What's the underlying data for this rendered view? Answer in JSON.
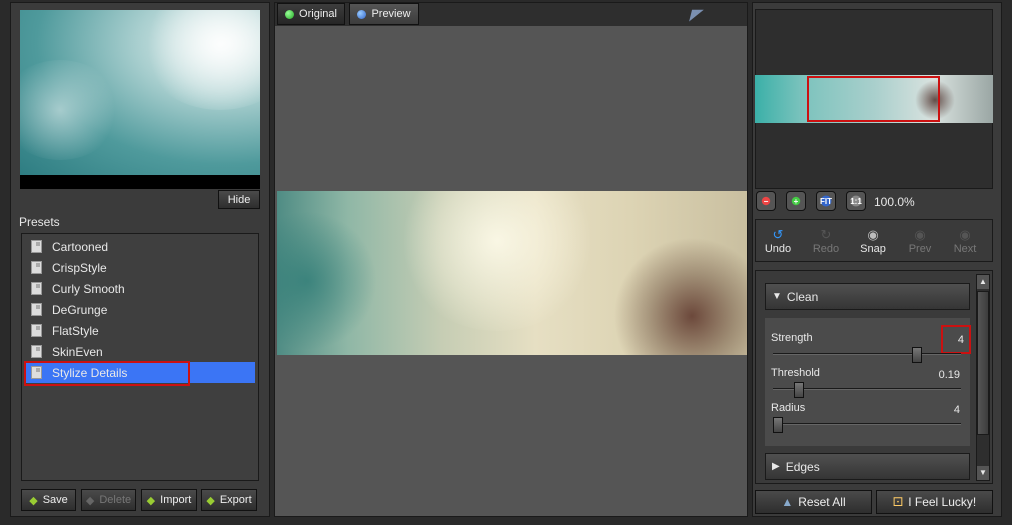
{
  "tabs": {
    "original": "Original",
    "preview": "Preview"
  },
  "left": {
    "hide_label": "Hide",
    "presets_label": "Presets",
    "presets": [
      "Cartooned",
      "CrispStyle",
      "Curly Smooth",
      "DeGrunge",
      "FlatStyle",
      "SkinEven",
      "Stylize Details"
    ],
    "selected_index": 6,
    "buttons": {
      "save": "Save",
      "delete": "Delete",
      "import": "Import",
      "export": "Export"
    }
  },
  "nav": {
    "zoom_level": "100.0%",
    "fit": "FIT",
    "one_to_one": "1:1"
  },
  "toolbar": {
    "undo": "Undo",
    "redo": "Redo",
    "snap": "Snap",
    "prev": "Prev",
    "next": "Next"
  },
  "settings": {
    "clean_label": "Clean",
    "strength_label": "Strength",
    "strength_value": "4",
    "strength_pos": 0.78,
    "threshold_label": "Threshold",
    "threshold_value": "0.19",
    "threshold_pos": 0.12,
    "radius_label": "Radius",
    "radius_value": "4",
    "radius_pos": 0.0,
    "edges_label": "Edges"
  },
  "bottom": {
    "reset_all": "Reset All",
    "feel_lucky": "I Feel Lucky!"
  },
  "colors": {
    "selection": "#3b75f5",
    "highlight_box": "#cc1111"
  }
}
